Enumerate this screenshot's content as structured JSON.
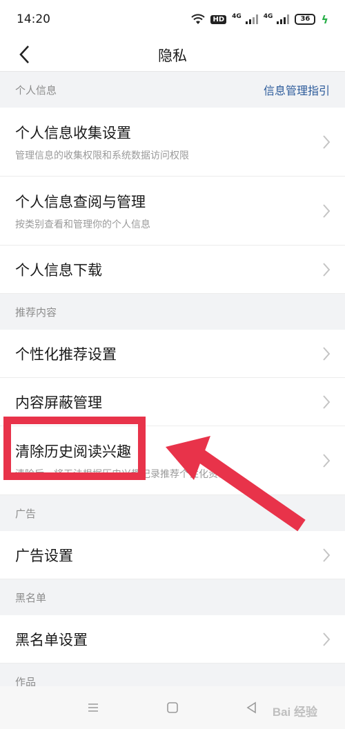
{
  "status": {
    "time": "14:20",
    "hd": "HD",
    "net1": "4G",
    "net2": "4G",
    "battery": "36"
  },
  "nav": {
    "title": "隐私"
  },
  "sections": [
    {
      "header": "个人信息",
      "link": "信息管理指引",
      "items": [
        {
          "title": "个人信息收集设置",
          "sub": "管理信息的收集权限和系统数据访问权限"
        },
        {
          "title": "个人信息查阅与管理",
          "sub": "按类别查看和管理你的个人信息"
        },
        {
          "title": "个人信息下载"
        }
      ]
    },
    {
      "header": "推荐内容",
      "items": [
        {
          "title": "个性化推荐设置"
        },
        {
          "title": "内容屏蔽管理"
        },
        {
          "title": "清除历史阅读兴趣",
          "sub": "清除后，将无法根据历史兴趣记录推荐个性化资讯"
        }
      ]
    },
    {
      "header": "广告",
      "items": [
        {
          "title": "广告设置"
        }
      ]
    },
    {
      "header": "黑名单",
      "items": [
        {
          "title": "黑名单设置"
        }
      ]
    },
    {
      "header": "作品"
    }
  ],
  "watermark": "Bai 经验",
  "colors": {
    "accent_link": "#2b5a9a",
    "annotation": "#e8334a"
  }
}
